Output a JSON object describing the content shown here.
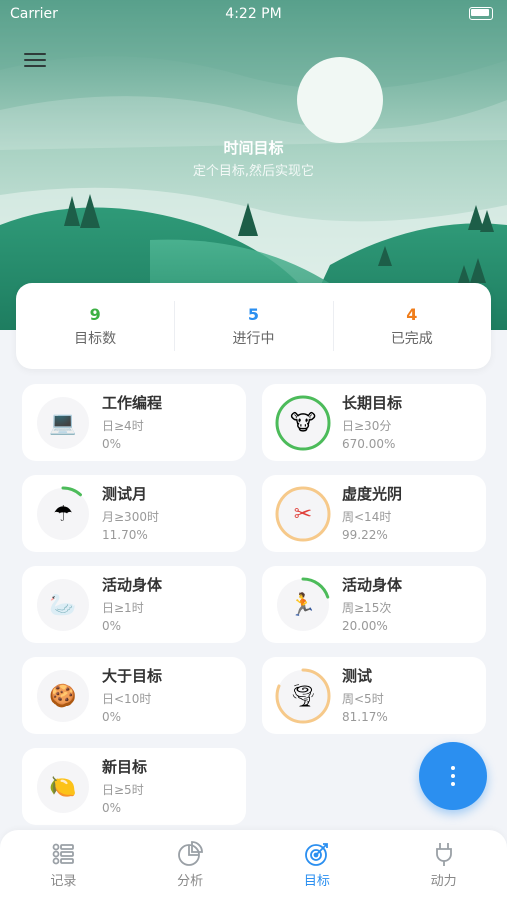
{
  "status_bar": {
    "carrier": "Carrier",
    "time": "4:22 PM"
  },
  "header": {
    "title": "时间目标",
    "subtitle": "定个目标,然后实现它"
  },
  "stats": [
    {
      "value": "9",
      "label": "目标数",
      "color": "#3cb043"
    },
    {
      "value": "5",
      "label": "进行中",
      "color": "#2b8ff0"
    },
    {
      "value": "4",
      "label": "已完成",
      "color": "#f07d1a"
    }
  ],
  "goals": [
    {
      "title": "工作编程",
      "condition": "日≥4时",
      "percent": "0%",
      "progress": 0,
      "ring_color": "#4cbb5a",
      "icon": "laptop-icon",
      "glyph": "💻"
    },
    {
      "title": "长期目标",
      "condition": "日≥30分",
      "percent": "670.00%",
      "progress": 1,
      "ring_color": "#4cbb5a",
      "icon": "cow-icon",
      "glyph": "🐮"
    },
    {
      "title": "测试月",
      "condition": "月≥300时",
      "percent": "11.70%",
      "progress": 0.117,
      "ring_color": "#4cbb5a",
      "icon": "umbrella-icon",
      "glyph": "☂"
    },
    {
      "title": "虚度光阴",
      "condition": "周<14时",
      "percent": "99.22%",
      "progress": 0.9922,
      "ring_color": "#f6c98a",
      "icon": "scissors-icon",
      "glyph": "✂"
    },
    {
      "title": "活动身体",
      "condition": "日≥1时",
      "percent": "0%",
      "progress": 0,
      "ring_color": "#4cbb5a",
      "icon": "swan-icon",
      "glyph": "🦢"
    },
    {
      "title": "活动身体",
      "condition": "周≥15次",
      "percent": "20.00%",
      "progress": 0.2,
      "ring_color": "#4cbb5a",
      "icon": "running-icon",
      "glyph": "🏃"
    },
    {
      "title": "大于目标",
      "condition": "日<10时",
      "percent": "0%",
      "progress": 0,
      "ring_color": "#f6c98a",
      "icon": "gingerbread-icon",
      "glyph": "🍪"
    },
    {
      "title": "测试",
      "condition": "周<5时",
      "percent": "81.17%",
      "progress": 0.8117,
      "ring_color": "#f6c98a",
      "icon": "tornado-icon",
      "glyph": "🌪"
    },
    {
      "title": "新目标",
      "condition": "日≥5时",
      "percent": "0%",
      "progress": 0,
      "ring_color": "#4cbb5a",
      "icon": "lemon-icon",
      "glyph": "🍋"
    }
  ],
  "tabs": [
    {
      "label": "记录",
      "icon": "record-icon",
      "active": false
    },
    {
      "label": "分析",
      "icon": "pie-chart-icon",
      "active": false
    },
    {
      "label": "目标",
      "icon": "target-icon",
      "active": true
    },
    {
      "label": "动力",
      "icon": "plug-icon",
      "active": false
    }
  ],
  "colors": {
    "accent": "#2b8ff0",
    "green": "#3cb043",
    "orange": "#f07d1a"
  }
}
